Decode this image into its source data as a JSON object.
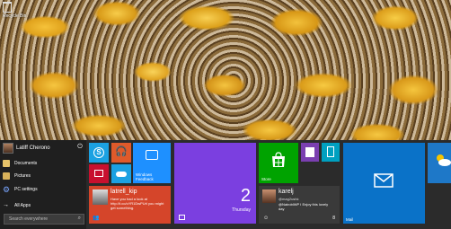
{
  "desktop": {
    "recycle_bin_label": "Recycle Bin"
  },
  "start_menu": {
    "user_name": "Latiff Cherono",
    "nav": [
      {
        "label": "Documents",
        "icon": "documents-icon"
      },
      {
        "label": "Pictures",
        "icon": "pictures-icon"
      },
      {
        "label": "PC settings",
        "icon": "gear-icon"
      }
    ],
    "all_apps_label": "All Apps",
    "search_placeholder": "Search everywhere"
  },
  "tiles": {
    "windows_feedback": "Windows Feedback",
    "twitter_user": "latrell_kip",
    "twitter_text": "Have you had a look at http://t.co/cYR1DwPUrl you might get something.",
    "calendar_date": "2",
    "calendar_day": "Thursday",
    "store_label": "Store",
    "people_user": "karelj",
    "people_handle": "@mag2ushk",
    "people_text": "@NairobiWP I Enjoy this lovely day",
    "people_badge": "8",
    "mail_label": "Mail"
  },
  "colors": {
    "skype": "#1ba1e2",
    "music": "#e05a2a",
    "video": "#c8102e",
    "feedback": "#1e90ff",
    "twitter": "#d5452a",
    "calendar": "#7b3fe0",
    "store": "#00a300",
    "onenote": "#7a3fb0",
    "reader": "#00a0c0",
    "people": "#3a3a3a",
    "mail": "#0a72c8",
    "weather": "#1e78c8"
  }
}
